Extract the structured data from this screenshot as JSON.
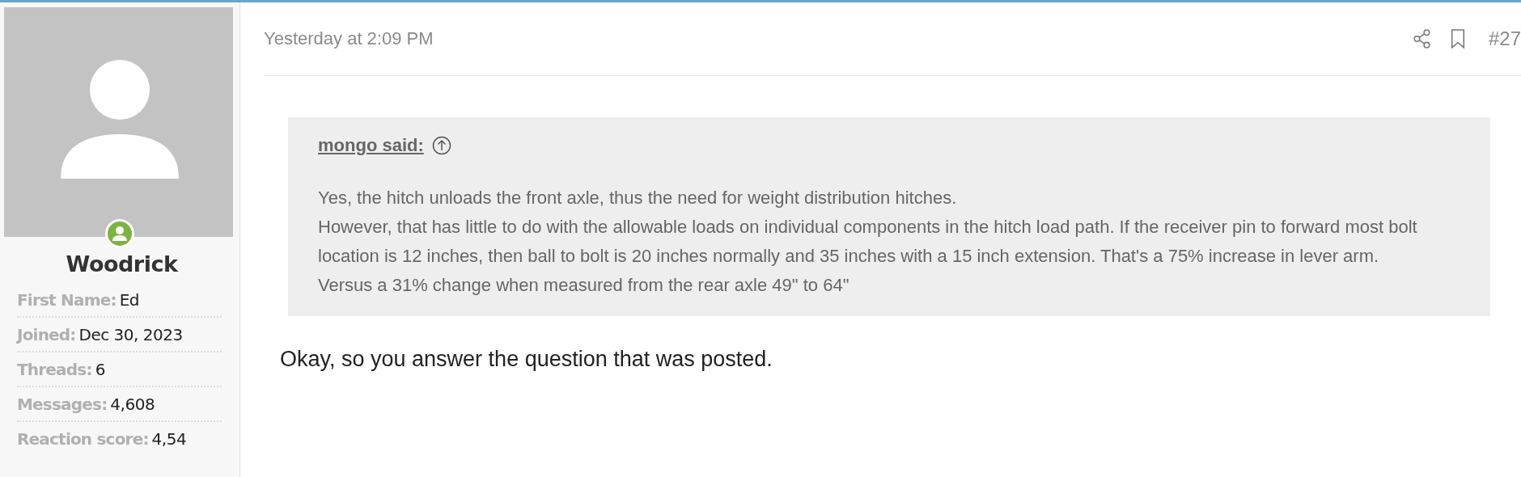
{
  "user": {
    "name": "Woodrick",
    "online": true,
    "stats": [
      {
        "label": "First Name:",
        "value": "Ed"
      },
      {
        "label": "Joined:",
        "value": "Dec 30, 2023"
      },
      {
        "label": "Threads:",
        "value": "6"
      },
      {
        "label": "Messages:",
        "value": "4,608"
      },
      {
        "label": "Reaction score:",
        "value": "4,54"
      }
    ]
  },
  "post": {
    "date": "Yesterday at 2:09 PM",
    "number": "#27",
    "quote": {
      "author": "mongo said:",
      "paragraphs": [
        "Yes, the hitch unloads the front axle, thus the need for weight distribution hitches.",
        "However, that has little to do with the allowable loads on individual components in the hitch load path. If the receiver pin to forward most bolt location is 12 inches, then ball to bolt is 20 inches normally and 35 inches with a 15 inch extension. That's a 75% increase in lever arm.",
        "Versus a 31% change when measured from the rear axle 49\" to 64\""
      ]
    },
    "body": "Okay, so you answer the question that was posted."
  }
}
